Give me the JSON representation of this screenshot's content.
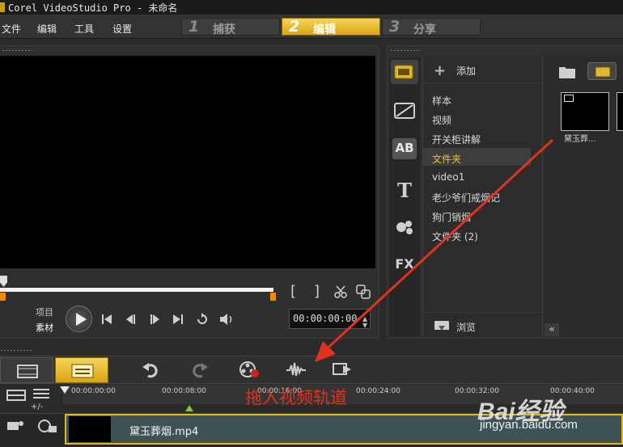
{
  "window": {
    "title": "Corel VideoStudio Pro - 未命名"
  },
  "menu": {
    "items": [
      "文件",
      "编辑",
      "工具",
      "设置"
    ]
  },
  "steps": [
    {
      "num": "1",
      "label": "捕获"
    },
    {
      "num": "2",
      "label": "编辑"
    },
    {
      "num": "3",
      "label": "分享"
    }
  ],
  "player": {
    "mode_project": "项目",
    "mode_clip": "素材",
    "mark_in": "[",
    "mark_out": "]",
    "timecode": "00:00:00:00"
  },
  "library": {
    "add_label": "添加",
    "folders": [
      "样本",
      "视频",
      "开关柜讲解",
      "文件夹",
      "video1",
      "老少爷们戒烟记",
      "狗门销烟",
      "文件夹 (2)"
    ],
    "selected_folder": "文件夹",
    "browse_label": "浏览",
    "tab_title": "AB",
    "tab_fx": "FX",
    "thumb_label": "黛玉葬..."
  },
  "timeline": {
    "tick_labels": [
      "00:00:00:00",
      "00:00:08:00",
      "00:00:16:00",
      "00:00:24:00",
      "00:00:32:00",
      "00:00:40:00"
    ],
    "zoom_label": "+/-",
    "clip_name": "黛玉葬烟.mp4"
  },
  "annotation": {
    "text": "拖入视频轨道",
    "color": "#e0321e"
  },
  "watermark": {
    "brand": "Bai经验",
    "url": "jingyan.baidu.com"
  },
  "colors": {
    "accent": "#e8b520",
    "clip_border": "#e0b81c",
    "trim_marker": "#f08a00"
  }
}
